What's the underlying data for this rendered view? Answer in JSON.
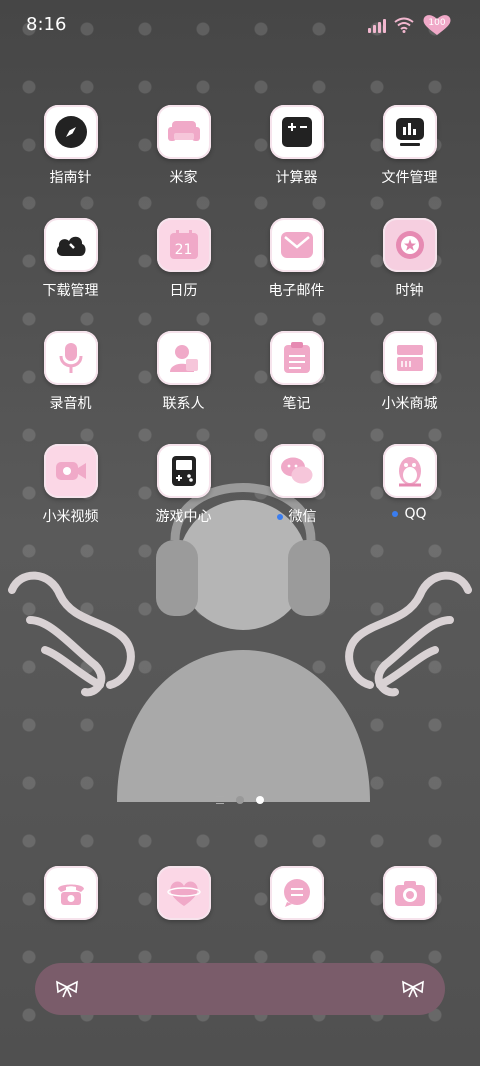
{
  "status_bar": {
    "time": "8:16",
    "battery": "100"
  },
  "apps": [
    {
      "label": "指南针",
      "icon": "compass-icon"
    },
    {
      "label": "米家",
      "icon": "sofa-icon"
    },
    {
      "label": "计算器",
      "icon": "calculator-icon"
    },
    {
      "label": "文件管理",
      "icon": "file-manager-icon"
    },
    {
      "label": "下载管理",
      "icon": "cloud-download-icon"
    },
    {
      "label": "日历",
      "icon": "calendar-icon",
      "badge": "21"
    },
    {
      "label": "电子邮件",
      "icon": "mail-icon"
    },
    {
      "label": "时钟",
      "icon": "clock-icon"
    },
    {
      "label": "录音机",
      "icon": "microphone-icon"
    },
    {
      "label": "联系人",
      "icon": "contact-icon"
    },
    {
      "label": "笔记",
      "icon": "notes-icon"
    },
    {
      "label": "小米商城",
      "icon": "store-icon"
    },
    {
      "label": "小米视频",
      "icon": "video-camera-icon"
    },
    {
      "label": "游戏中心",
      "icon": "gamepad-icon"
    },
    {
      "label": "微信",
      "icon": "wechat-icon",
      "dot": true
    },
    {
      "label": "QQ",
      "icon": "qq-penguin-icon",
      "dot": true
    }
  ],
  "dock": [
    {
      "icon": "phone-icon"
    },
    {
      "icon": "planet-heart-icon"
    },
    {
      "icon": "message-icon"
    },
    {
      "icon": "camera-icon"
    }
  ],
  "colors": {
    "pink": "#f0a9c8",
    "dark": "#222222",
    "searchbar": "#7a5c6a"
  }
}
